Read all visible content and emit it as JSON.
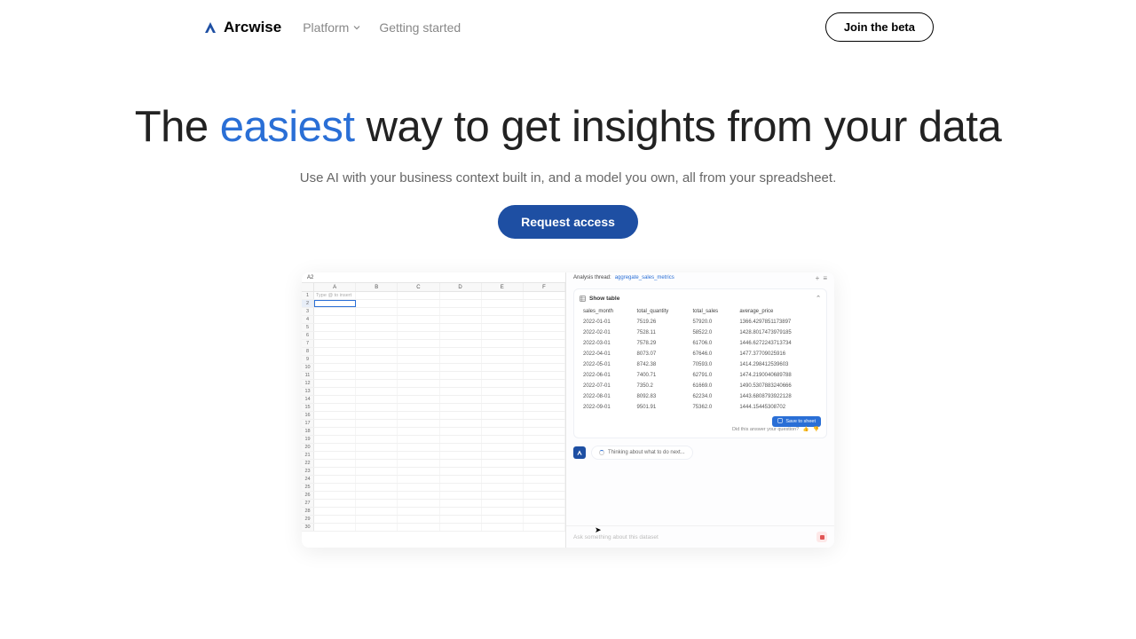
{
  "header": {
    "brand": "Arcwise",
    "nav": {
      "platform": "Platform",
      "getting_started": "Getting started"
    },
    "beta": "Join the beta"
  },
  "hero": {
    "h1_pre": "The ",
    "h1_accent": "easiest",
    "h1_post": " way to get insights from your data",
    "sub": "Use AI with your business context built in, and a model you own, all from your spreadsheet.",
    "cta": "Request access"
  },
  "sheet": {
    "address": "A2",
    "cols": [
      "A",
      "B",
      "C",
      "D",
      "E",
      "F"
    ],
    "hint": "Type @ to insert"
  },
  "chat": {
    "thread_label": "Analysis thread:",
    "thread_name": "aggregate_sales_metrics",
    "show_table": "Show table",
    "columns": [
      "sales_month",
      "total_quantity",
      "total_sales",
      "average_price"
    ],
    "rows": [
      [
        "2022-01-01",
        "7519.26",
        "57920.0",
        "1366.4297851173897"
      ],
      [
        "2022-02-01",
        "7528.11",
        "58522.0",
        "1428.8017473979185"
      ],
      [
        "2022-03-01",
        "7578.29",
        "61706.0",
        "1446.6272243713734"
      ],
      [
        "2022-04-01",
        "8073.07",
        "67646.0",
        "1477.37709025916"
      ],
      [
        "2022-05-01",
        "8742.38",
        "70593.0",
        "1414.298412539603"
      ],
      [
        "2022-06-01",
        "7400.71",
        "62791.0",
        "1474.2190040689788"
      ],
      [
        "2022-07-01",
        "7350.2",
        "61669.0",
        "1490.5307883240666"
      ],
      [
        "2022-08-01",
        "8092.83",
        "62234.0",
        "1443.6808793922128"
      ],
      [
        "2022-09-01",
        "9501.91",
        "75362.0",
        "1444.15445308702"
      ]
    ],
    "save": "Save to sheet",
    "feedback": "Did this answer your question?",
    "thinking": "Thinking about what to do next...",
    "placeholder": "Ask something about this dataset"
  }
}
